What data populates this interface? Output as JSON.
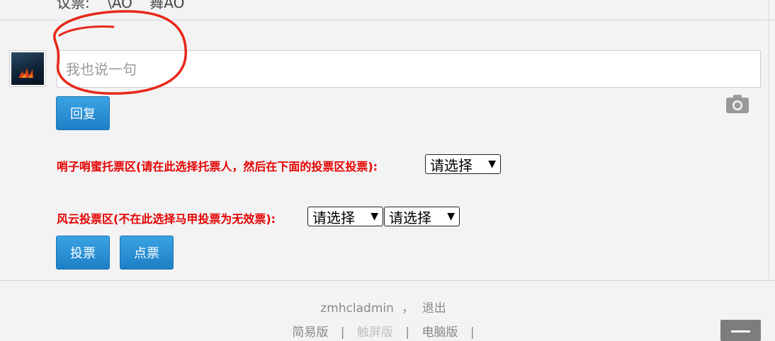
{
  "top": {
    "vote_label": "议票:",
    "item1": "\\AO",
    "item2": "舞AO"
  },
  "reply": {
    "placeholder": "我也说一句",
    "button": "回复"
  },
  "vote_section1": {
    "label": "哨子哨蜜托票区(请在此选择托票人，然后在下面的投票区投票):",
    "select_value": "请选择"
  },
  "vote_section2": {
    "label": "风云投票区(不在此选择马甲投票为无效票):",
    "select_value_1": "请选择",
    "select_value_2": "请选择"
  },
  "buttons": {
    "vote": "投票",
    "click_vote": "点票"
  },
  "footer": {
    "username": "zmhcladmin",
    "comma": "，",
    "logout": "退出",
    "links": [
      "简易版",
      "触屏版",
      "电脑版"
    ],
    "separator": "|"
  },
  "icons": {
    "camera": "camera-icon",
    "scroll": "menu-icon"
  },
  "colors": {
    "accent_blue": "#1d7fc6",
    "warning_red": "#e60000",
    "annotation_red": "#e8281a"
  }
}
